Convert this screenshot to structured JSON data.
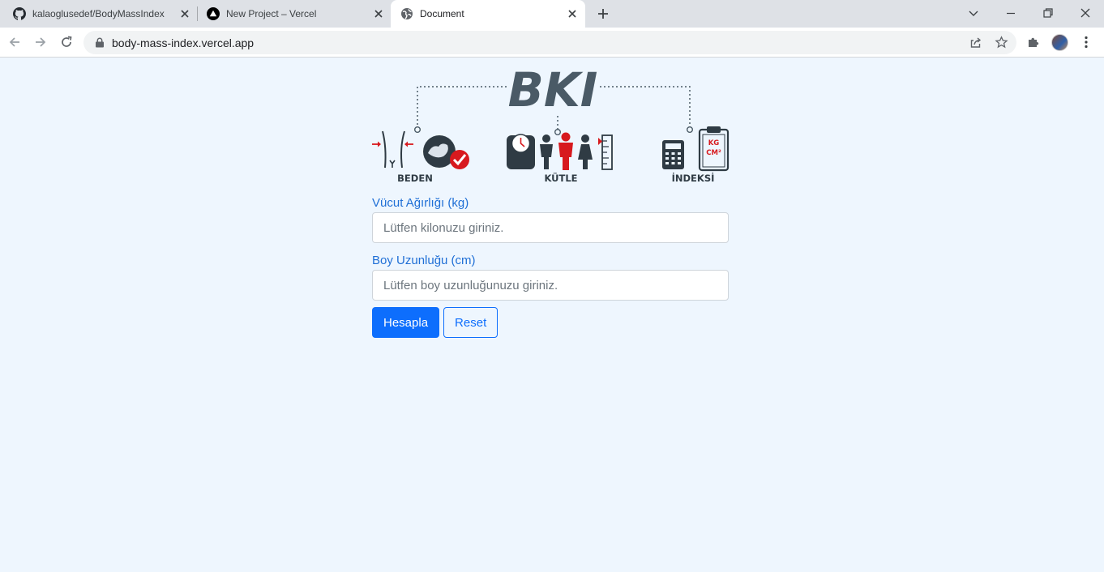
{
  "browser": {
    "tabs": [
      {
        "title": "kalaoglusedef/BodyMassIndex",
        "icon": "github-icon",
        "active": false
      },
      {
        "title": "New Project – Vercel",
        "icon": "vercel-icon",
        "active": false
      },
      {
        "title": "Document",
        "icon": "globe-icon",
        "active": true
      }
    ],
    "url": "body-mass-index.vercel.app"
  },
  "logo": {
    "title": "BKI",
    "groups": [
      "BEDEN",
      "KÜTLE",
      "İNDEKSİ"
    ],
    "clipboard_text": [
      "KG",
      "CM²"
    ]
  },
  "form": {
    "weight_label": "Vücut Ağırlığı (kg)",
    "weight_placeholder": "Lütfen kilonuzu giriniz.",
    "height_label": "Boy Uzunluğu (cm)",
    "height_placeholder": "Lütfen boy uzunluğunuzu giriniz.",
    "calculate_label": "Hesapla",
    "reset_label": "Reset"
  },
  "colors": {
    "page_background": "#eef6fe",
    "label_blue": "#1f6fd6",
    "primary": "#0d6efd",
    "logo_dark": "#4a5a66",
    "logo_red": "#d7191e"
  }
}
